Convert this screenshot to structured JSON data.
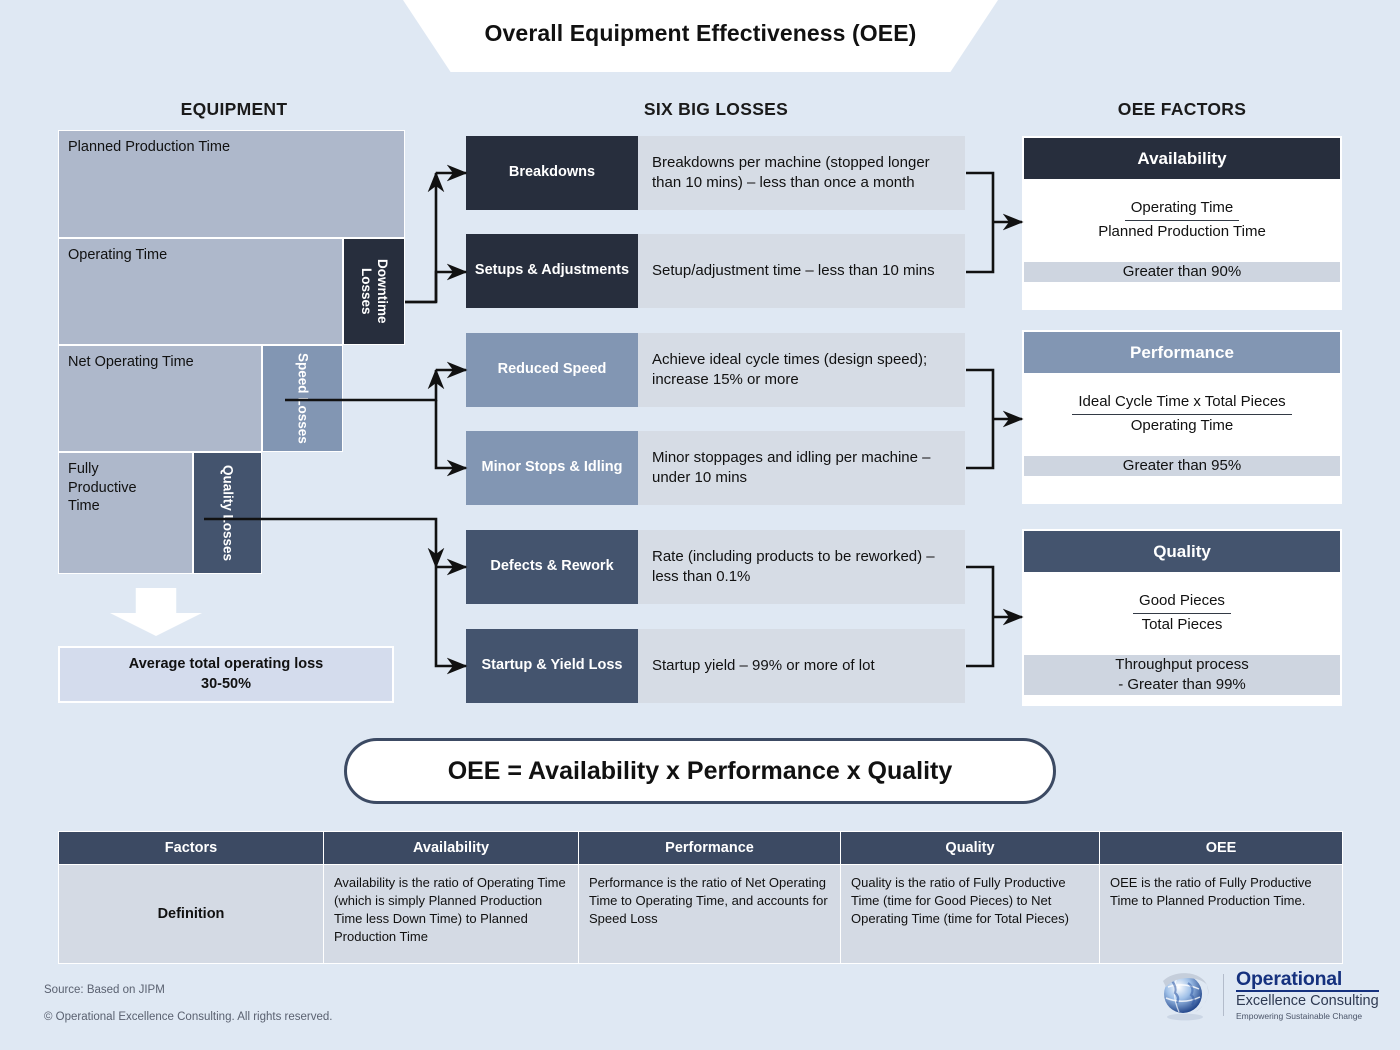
{
  "header": {
    "title": "Overall Equipment Effectiveness (OEE)"
  },
  "columns": {
    "equipment": "EQUIPMENT",
    "losses": "SIX BIG LOSSES",
    "factors": "OEE FACTORS"
  },
  "equipment": {
    "bars": [
      {
        "label": "Planned Production Time"
      },
      {
        "label": "Operating Time"
      },
      {
        "label": "Net Operating Time"
      },
      {
        "label": "Fully\nProductive\nTime"
      }
    ],
    "loss_blocks": [
      {
        "label": "Downtime Losses",
        "color": "#272e3d"
      },
      {
        "label": "Speed Losses",
        "color": "#8296b3"
      },
      {
        "label": "Quality Losses",
        "color": "#44546e"
      }
    ],
    "average_loss": {
      "line1": "Average total operating loss",
      "line2": "30-50%"
    }
  },
  "six_big_losses": [
    {
      "name": "Breakdowns",
      "description": "Breakdowns per machine (stopped longer than 10 mins) – less than once a month",
      "color": "#272e3d"
    },
    {
      "name": "Setups & Adjustments",
      "description": "Setup/adjustment time – less than 10 mins",
      "color": "#272e3d"
    },
    {
      "name": "Reduced Speed",
      "description": "Achieve ideal cycle times (design speed); increase 15% or more",
      "color": "#8296b3"
    },
    {
      "name": "Minor Stops & Idling",
      "description": "Minor stoppages and idling per machine – under 10 mins",
      "color": "#8296b3"
    },
    {
      "name": "Defects & Rework",
      "description": "Rate (including products to be reworked) – less than 0.1%",
      "color": "#44546e"
    },
    {
      "name": "Startup & Yield Loss",
      "description": "Startup yield – 99% or more of lot",
      "color": "#44546e"
    }
  ],
  "oee_factors": [
    {
      "name": "Availability",
      "numerator": "Operating Time",
      "denominator": "Planned Production Time",
      "target_line1": "Greater than 90%",
      "target_line2": "",
      "color": "#272e3d"
    },
    {
      "name": "Performance",
      "numerator": "Ideal Cycle Time x Total Pieces",
      "denominator": "Operating Time",
      "target_line1": "Greater than 95%",
      "target_line2": "",
      "color": "#8296b3"
    },
    {
      "name": "Quality",
      "numerator": "Good Pieces",
      "denominator": "Total Pieces",
      "target_line1": "Throughput process",
      "target_line2": "- Greater than 99%",
      "color": "#44546e"
    }
  ],
  "equation": "OEE = Availability x Performance x Quality",
  "definition_table": {
    "headers": [
      "Factors",
      "Availability",
      "Performance",
      "Quality",
      "OEE"
    ],
    "row_label": "Definition",
    "cells": [
      "Availability is the ratio of Operating Time (which is simply Planned Production Time less Down Time) to Planned Production Time",
      "Performance is the ratio of Net Operating Time to Operating Time, and accounts for Speed Loss",
      "Quality is the ratio of Fully Productive Time (time for Good Pieces) to Net Operating Time (time for Total Pieces)",
      "OEE is the ratio of Fully Productive Time to Planned Production Time."
    ]
  },
  "footer": {
    "source": "Source: Based on JIPM",
    "copyright": "© Operational Excellence Consulting. All rights reserved.",
    "logo_line1": "Operational",
    "logo_line2": "Excellence Consulting",
    "logo_line3": "Empowering Sustainable Change"
  },
  "colors": {
    "page_bg": "#dfe8f3",
    "bar": "#aeb8cb",
    "dark": "#272e3d",
    "mid": "#8296b3",
    "slate": "#44546e",
    "desc_bg": "#d6dce5",
    "target_bg": "#ced5e0",
    "table_head": "#3c4a63"
  }
}
